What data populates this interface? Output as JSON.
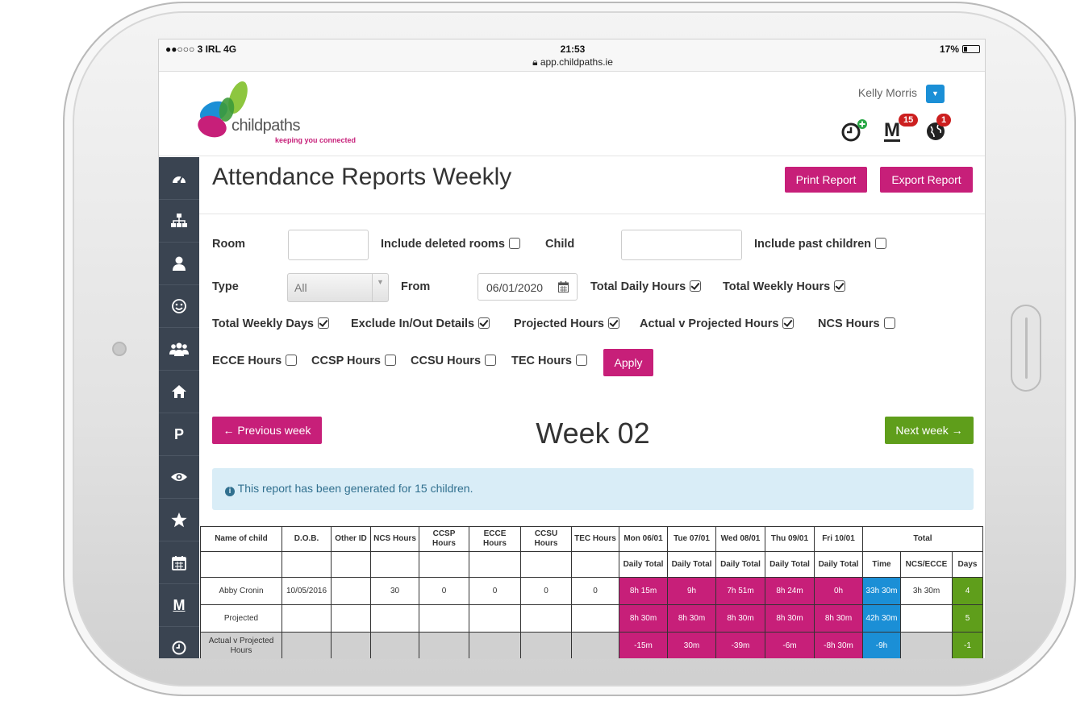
{
  "status_bar": {
    "carrier": "●●○○○ 3 IRL   4G",
    "time": "21:53",
    "url": "app.childpaths.ie",
    "battery": "17%"
  },
  "header": {
    "logo_text": "childpaths",
    "logo_tagline": "keeping you connected",
    "user_name": "Kelly Morris",
    "badge_messages": "15",
    "badge_globe": "1",
    "messages_letter": "M"
  },
  "sidebar": {
    "icons": [
      "dashboard-icon",
      "sitemap-icon",
      "user-icon",
      "smile-icon",
      "group-icon",
      "home-icon",
      "parking-icon",
      "eye-icon",
      "star-icon",
      "calendar-icon",
      "messages-icon",
      "clock-icon"
    ],
    "p_label": "P",
    "m_label": "M"
  },
  "page": {
    "title": "Attendance Reports Weekly",
    "print_label": "Print Report",
    "export_label": "Export Report"
  },
  "filters": {
    "room_label": "Room",
    "include_deleted_rooms": "Include deleted rooms",
    "child_label": "Child",
    "include_past_children": "Include past children",
    "type_label": "Type",
    "type_value": "All",
    "from_label": "From",
    "from_value": "06/01/2020",
    "total_daily_hours": "Total Daily Hours",
    "total_weekly_hours": "Total Weekly Hours",
    "total_weekly_days": "Total Weekly Days",
    "exclude_inout": "Exclude In/Out Details",
    "projected_hours": "Projected Hours",
    "actual_v_projected": "Actual v Projected Hours",
    "ncs_hours": "NCS Hours",
    "ecce_hours": "ECCE Hours",
    "ccsp_hours": "CCSP Hours",
    "ccsu_hours": "CCSU Hours",
    "tec_hours": "TEC Hours",
    "apply_label": "Apply"
  },
  "week": {
    "prev_label": "Previous week",
    "next_label": "Next week",
    "title": "Week 02",
    "info": "This report has been generated for 15 children."
  },
  "table": {
    "head": {
      "name": "Name of child",
      "dob": "D.O.B.",
      "other": "Other ID",
      "ncs": "NCS Hours",
      "ccsp": "CCSP Hours",
      "ecce": "ECCE Hours",
      "ccsu": "CCSU Hours",
      "tec": "TEC Hours",
      "mon": "Mon 06/01",
      "tue": "Tue 07/01",
      "wed": "Wed 08/01",
      "thu": "Thu 09/01",
      "fri": "Fri 10/01",
      "total": "Total",
      "daily_total": "Daily Total",
      "time": "Time",
      "ncs_ecce": "NCS/ECCE",
      "days": "Days"
    },
    "rows": [
      {
        "name": "Abby Cronin",
        "dob": "10/05/2016",
        "other": "",
        "ncs": "30",
        "ccsp": "0",
        "ecce": "0",
        "ccsu": "0",
        "tec": "0",
        "mon": "8h 15m",
        "tue": "9h",
        "wed": "7h 51m",
        "thu": "8h 24m",
        "fri": "0h",
        "time": "33h 30m",
        "ncs_ecce": "3h 30m",
        "days": "4"
      },
      {
        "name": "Projected",
        "mon": "8h 30m",
        "tue": "8h 30m",
        "wed": "8h 30m",
        "thu": "8h 30m",
        "fri": "8h 30m",
        "time": "42h 30m",
        "ncs_ecce": "",
        "days": "5"
      },
      {
        "name": "Actual v Projected Hours",
        "mon": "-15m",
        "tue": "30m",
        "wed": "-39m",
        "thu": "-6m",
        "fri": "-8h 30m",
        "time": "-9h",
        "ncs_ecce": "",
        "days": "-1"
      }
    ]
  },
  "colors": {
    "brand_pink": "#c71f79",
    "next_green": "#5f9e1b",
    "blue": "#1b8fd6",
    "sidebar": "#3a4451"
  }
}
